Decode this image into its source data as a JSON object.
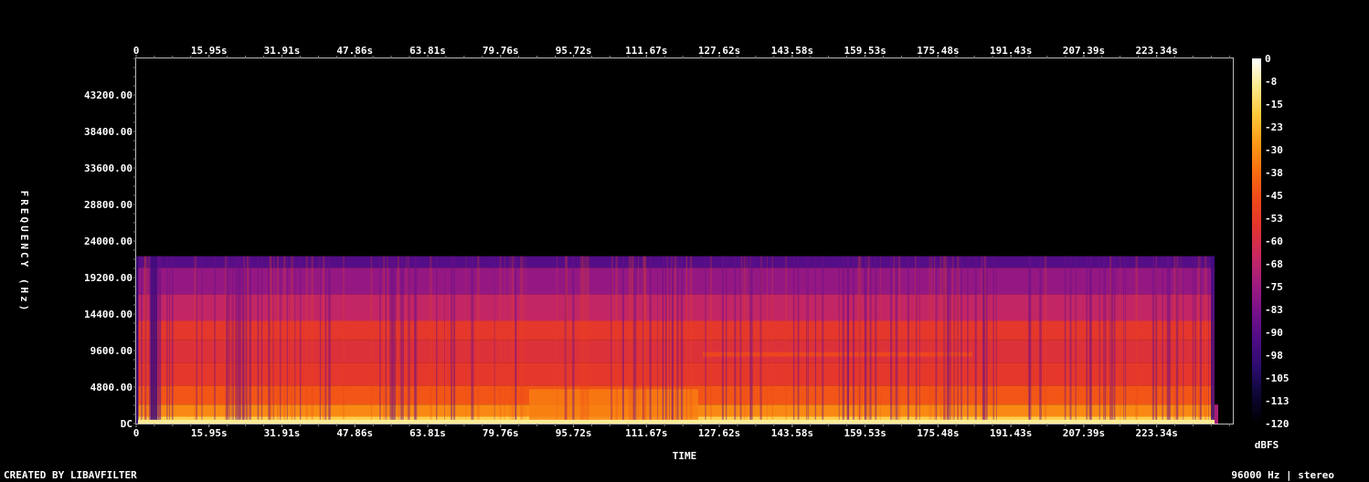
{
  "footer_left": "CREATED BY LIBAVFILTER",
  "footer_right": "96000 Hz | stereo",
  "chart_data": {
    "type": "heatmap",
    "xlabel": "TIME",
    "ylabel": "FREQUENCY (Hz)",
    "x_ticks": [
      "0",
      "15.95s",
      "31.91s",
      "47.86s",
      "63.81s",
      "79.76s",
      "95.72s",
      "111.67s",
      "127.62s",
      "143.58s",
      "159.53s",
      "175.48s",
      "191.43s",
      "207.39s",
      "223.34s"
    ],
    "x_tick_values": [
      0,
      15.95,
      31.91,
      47.86,
      63.81,
      79.76,
      95.72,
      111.67,
      127.62,
      143.58,
      159.53,
      175.48,
      191.43,
      207.39,
      223.34
    ],
    "xlim": [
      0,
      240
    ],
    "audio_end_s": 236,
    "y_ticks": [
      "DC",
      "4800.00",
      "9600.00",
      "14400.00",
      "19200.00",
      "24000.00",
      "28800.00",
      "33600.00",
      "38400.00",
      "43200.00"
    ],
    "y_tick_values": [
      0,
      4800,
      9600,
      14400,
      19200,
      24000,
      28800,
      33600,
      38400,
      43200
    ],
    "ylim": [
      0,
      48000
    ],
    "content_max_frequency_hz": 22000,
    "colorbar": {
      "label": "dBFS",
      "ticks": [
        "0",
        "-8",
        "-15",
        "-23",
        "-30",
        "-38",
        "-45",
        "-53",
        "-60",
        "-68",
        "-75",
        "-83",
        "-90",
        "-98",
        "-105",
        "-113",
        "-120"
      ],
      "range": [
        -120,
        0
      ],
      "colors": [
        "#000000",
        "#0b0633",
        "#2c0c6e",
        "#4f0c86",
        "#78118a",
        "#a21c7e",
        "#c9285f",
        "#e3342e",
        "#f0491a",
        "#f76e0f",
        "#fb9a16",
        "#fcc93a",
        "#fbe98a",
        "#ffffff"
      ]
    }
  }
}
